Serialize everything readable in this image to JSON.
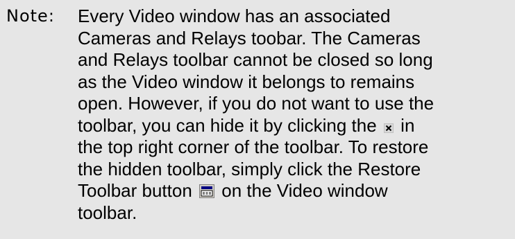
{
  "colors": {
    "background": "#e6e6e6"
  },
  "note": {
    "label": "Note:",
    "lines": [
      "Every Video window has an associated",
      "Cameras and Relays toobar. The Cameras",
      "and Relays toolbar cannot be closed so long",
      "as the Video window it belongs to remains",
      "open. However, if you do not want to use the",
      "toolbar, you can hide it by clicking the",
      "in",
      "the top right corner of the toolbar. To restore",
      "the hidden toolbar, simply click the Restore",
      "Toolbar button",
      "on the Video window",
      "toolbar."
    ],
    "icons": [
      "close-icon",
      "restore-toolbar-icon"
    ]
  }
}
